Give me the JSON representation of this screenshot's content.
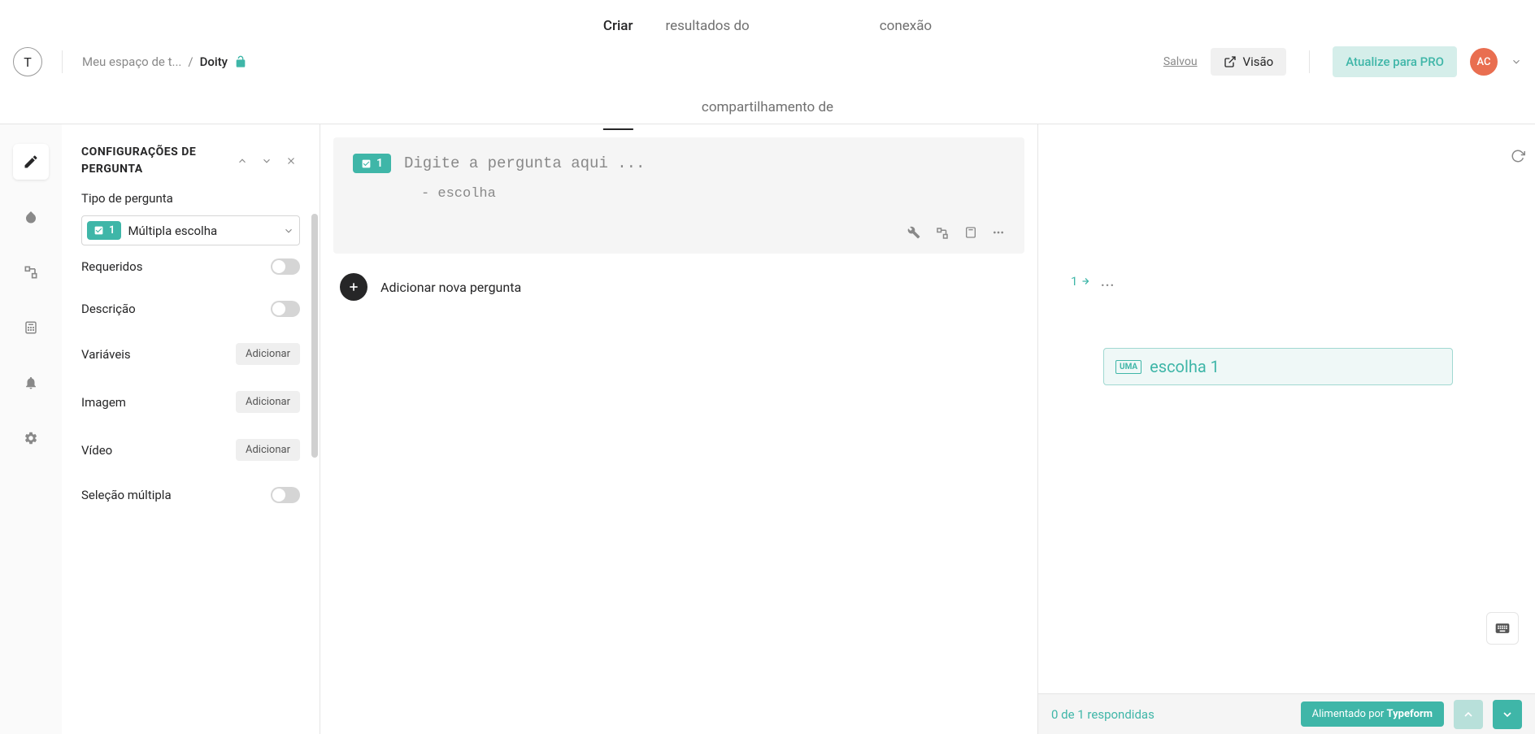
{
  "header": {
    "logo_letter": "T",
    "breadcrumb_workspace": "Meu espaço de t...",
    "breadcrumb_sep": "/",
    "breadcrumb_current": "Doity",
    "tabs": {
      "create": "Criar",
      "share": "compartilhamento de",
      "results": "resultados do",
      "connect": "conexão"
    },
    "saved": "Salvou",
    "preview": "Visão",
    "upgrade": "Atualize para PRO",
    "avatar": "AC"
  },
  "settings": {
    "title": "CONFIGURAÇÕES DE PERGUNTA",
    "question_type_label": "Tipo de pergunta",
    "type_badge_num": "1",
    "type_name": "Múltipla escolha",
    "rows": {
      "required": "Requeridos",
      "description": "Descrição",
      "variables": "Variáveis",
      "image": "Imagem",
      "video": "Vídeo",
      "multiple_selection": "Seleção múltipla"
    },
    "add_label": "Adicionar"
  },
  "editor": {
    "q_badge_num": "1",
    "placeholder": "Digite a pergunta aqui ...",
    "choice_prefix": "- escolha",
    "add_question": "Adicionar nova pergunta"
  },
  "preview": {
    "qnum": "1",
    "dots": "...",
    "choice_key": "UMA",
    "choice_text": "escolha 1",
    "progress": "0 de 1 respondidas",
    "powered_prefix": "Alimentado por ",
    "powered_brand": "Typeform"
  }
}
